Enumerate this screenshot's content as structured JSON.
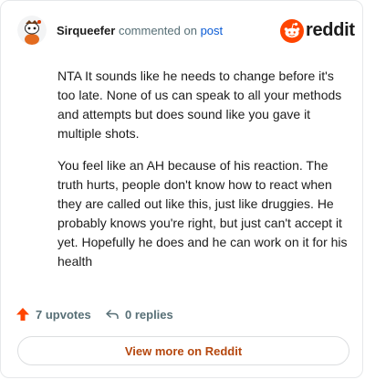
{
  "header": {
    "username": "Sirqueefer",
    "action_text": "commented on",
    "post_link": "post",
    "brand": "reddit"
  },
  "comment": {
    "paragraphs": [
      "NTA It sounds like he needs to change before it's too late. None of us can speak to all your methods and attempts but does sound like you gave it multiple shots.",
      "You feel like an AH because of his reaction. The truth hurts, people don't know how to react when they are called out like this, just like druggies. He probably knows you're right, but just can't accept it yet. Hopefully he does and he can work on it for his health"
    ]
  },
  "footer": {
    "upvotes_label": "7 upvotes",
    "replies_label": "0 replies",
    "view_more_label": "View more on Reddit"
  },
  "colors": {
    "brand_orange": "#ff4500",
    "link_blue": "#0a5bd6",
    "view_more": "#b5470e"
  }
}
